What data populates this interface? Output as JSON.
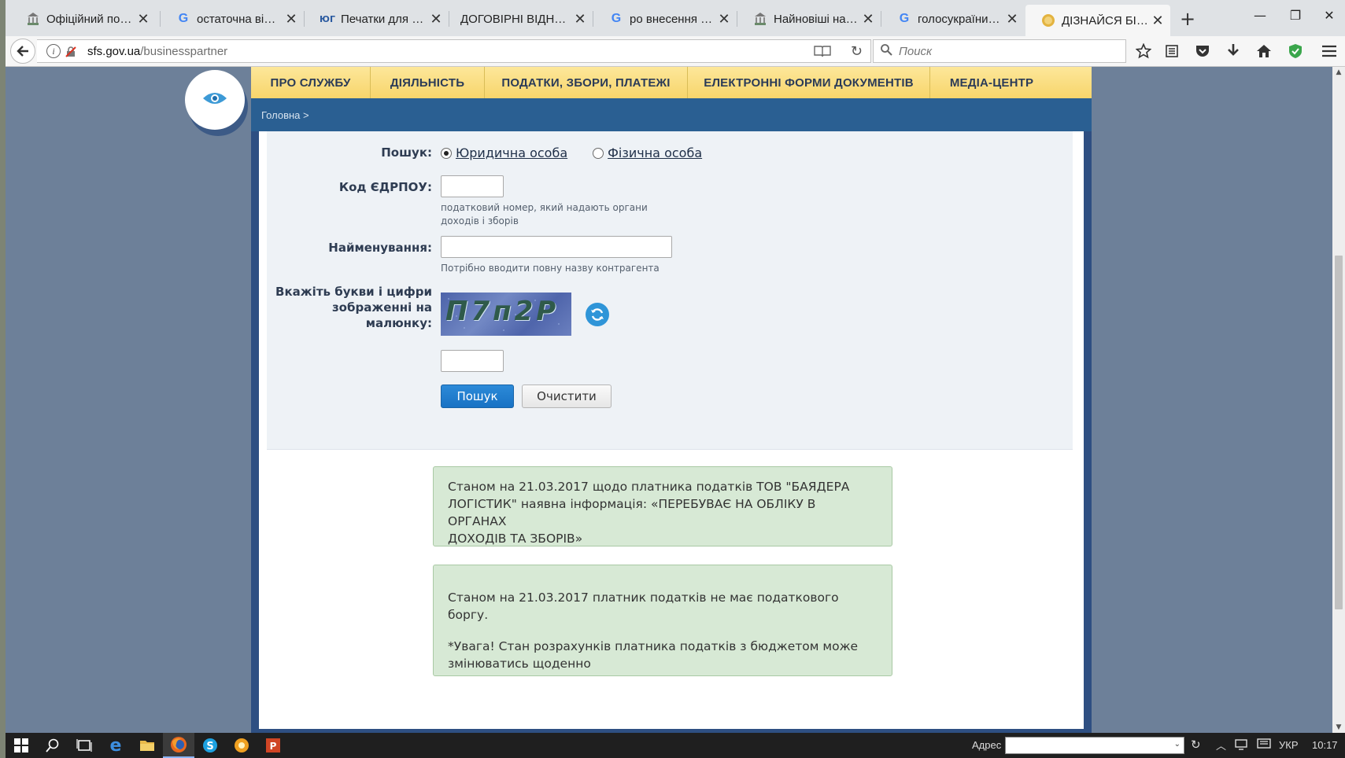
{
  "browser": {
    "tabs": [
      {
        "label": "Офіційний порт...",
        "icon": "sfs-favicon"
      },
      {
        "label": "остаточна відмі...",
        "icon": "google-favicon"
      },
      {
        "label": "Печатки для біз...",
        "icon": "ug-favicon"
      },
      {
        "label": "ДОГОВІРНІ ВІДНОСИ...",
        "icon": "none"
      },
      {
        "label": "ро внесення змі...",
        "icon": "google-favicon"
      },
      {
        "label": "Найновіші надх...",
        "icon": "sfs-favicon"
      },
      {
        "label": "голосукраїни - ...",
        "icon": "google-favicon"
      },
      {
        "label": "ДІЗНАЙСЯ БІЛЬ...",
        "icon": "coin-favicon",
        "active": true
      }
    ],
    "url_host": "sfs.gov.ua",
    "url_path": "/businesspartner",
    "search_placeholder": "Поиск"
  },
  "site": {
    "menu": [
      "ПРО СЛУЖБУ",
      "ДІЯЛЬНІСТЬ",
      "ПОДАТКИ, ЗБОРИ, ПЛАТЕЖІ",
      "ЕЛЕКТРОННІ ФОРМИ ДОКУМЕНТІВ",
      "МЕДІА-ЦЕНТР"
    ],
    "breadcrumb": "Головна >"
  },
  "form": {
    "search_label": "Пошук:",
    "option_legal": "Юридична особа",
    "option_person": "Фізична особа",
    "edrpou_label": "Код ЄДРПОУ:",
    "edrpou_value": "",
    "edrpou_hint_1": "податковий номер, який надають органи",
    "edrpou_hint_2": "доходів і зборів",
    "name_label": "Найменування:",
    "name_value": "",
    "name_hint": "Потрібно вводити повну назву контрагента",
    "captcha_label_1": "Вкажіть букви і цифри",
    "captcha_label_2": "зображенні на малюнку:",
    "captcha_text": "П7п2Р",
    "captcha_value": "",
    "search_button": "Пошук",
    "clear_button": "Очистити"
  },
  "results": {
    "status_1": "Станом на 21.03.2017 щодо платника податків ТОВ \"БАЯДЕРА",
    "status_2": "ЛОГІСТИК\" наявна інформація: «ПЕРЕБУВАЄ НА ОБЛІКУ В ОРГАНАХ",
    "status_3": "ДОХОДІВ ТА ЗБОРІВ»",
    "debt": "Станом на 21.03.2017 платник податків не має податкового боргу.",
    "warning_1": "*Увага! Стан розрахунків платника податків з бюджетом може",
    "warning_2": "змінюватись щоденно"
  },
  "taskbar": {
    "address_label": "Адрес",
    "language": "УКР",
    "time": "10:17"
  },
  "colors": {
    "menu_bg": "#f7d56b",
    "bar_blue": "#2a5f92",
    "result_green": "#d7e9d5",
    "button_blue": "#1872c4"
  }
}
